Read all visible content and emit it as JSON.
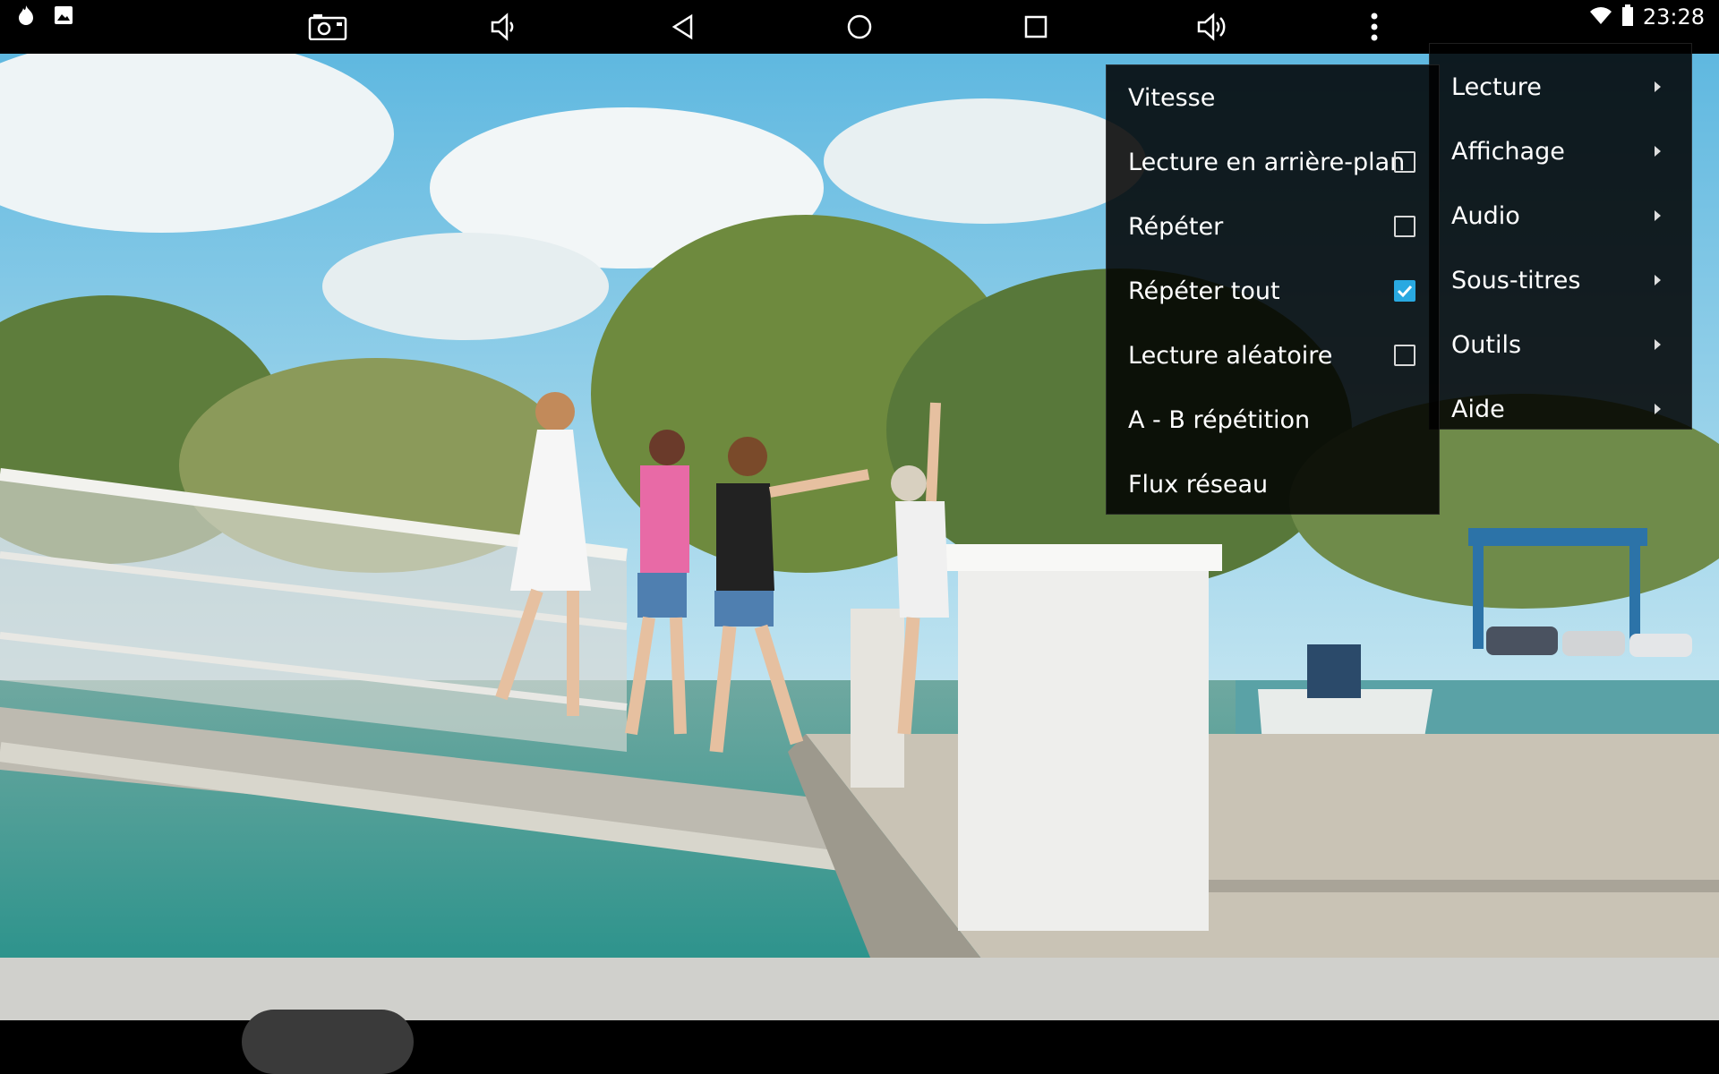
{
  "status_bar": {
    "time": "23:28",
    "left_icons": [
      "app-notification-icon",
      "image-notification-icon"
    ],
    "right_icons": [
      "wifi-icon",
      "battery-icon"
    ]
  },
  "menu": {
    "main": [
      {
        "label": "Lecture",
        "has_submenu": true
      },
      {
        "label": "Affichage",
        "has_submenu": true
      },
      {
        "label": "Audio",
        "has_submenu": true
      },
      {
        "label": "Sous-titres",
        "has_submenu": true
      },
      {
        "label": "Outils",
        "has_submenu": true
      },
      {
        "label": "Aide",
        "has_submenu": true
      }
    ],
    "lecture_submenu": [
      {
        "label": "Vitesse"
      },
      {
        "label": "Lecture en arrière-plan",
        "checkbox": true,
        "checked": false
      },
      {
        "label": "Répéter",
        "checkbox": true,
        "checked": false
      },
      {
        "label": "Répéter tout",
        "checkbox": true,
        "checked": true
      },
      {
        "label": "Lecture aléatoire",
        "checkbox": true,
        "checked": false
      },
      {
        "label": "A - B répétition"
      },
      {
        "label": "Flux réseau"
      }
    ]
  },
  "nav_bar": {
    "buttons": [
      "screenshot-icon",
      "volume-down-icon",
      "back-icon",
      "home-icon",
      "recents-icon",
      "volume-up-icon",
      "more-icon"
    ]
  },
  "colors": {
    "accent": "#29a9e1",
    "menu_bg": "#000000",
    "sky": "#7ec8e8",
    "water": "#3aa69b",
    "pier": "#c8c2b4"
  }
}
